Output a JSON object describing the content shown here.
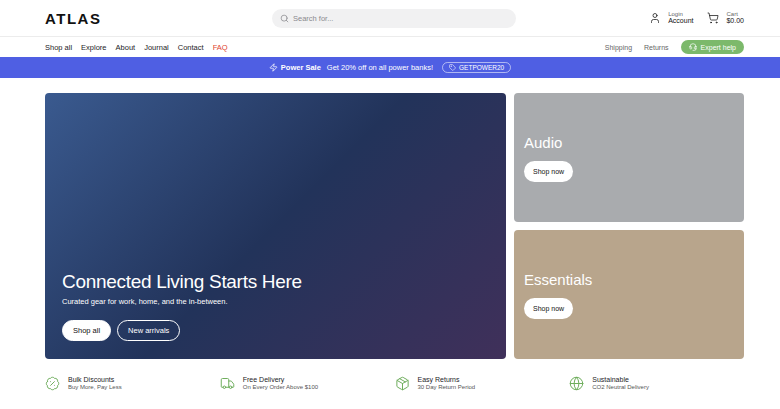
{
  "header": {
    "logo": "ATLAS",
    "search": {
      "placeholder": "Search for..."
    },
    "account": {
      "label": "Login",
      "sub": "Account"
    },
    "cart": {
      "label": "Cart",
      "amount": "$0.00"
    }
  },
  "nav": [
    {
      "label": "Shop all",
      "highlight": false
    },
    {
      "label": "Explore",
      "highlight": false
    },
    {
      "label": "About",
      "highlight": false
    },
    {
      "label": "Journal",
      "highlight": false
    },
    {
      "label": "Contact",
      "highlight": false
    },
    {
      "label": "FAQ",
      "highlight": true
    }
  ],
  "utility_links": [
    "Shipping",
    "Returns"
  ],
  "help_button": "Expert help",
  "banner": {
    "title": "Power Sale",
    "text": "Get 20% off on all power banks!",
    "code": "GETPOWER20"
  },
  "hero": {
    "title": "Connected Living Starts Here",
    "subtitle": "Curated gear for work, home, and the in-between.",
    "buttons": [
      {
        "label": "Shop all",
        "kind": "solid"
      },
      {
        "label": "New arrivals",
        "kind": "outline"
      }
    ]
  },
  "side_cards": [
    {
      "title": "Audio",
      "button": "Shop now"
    },
    {
      "title": "Essentials",
      "button": "Shop now"
    }
  ],
  "features": [
    {
      "title": "Bulk Discounts",
      "sub": "Buy More, Pay Less",
      "kind": "discount"
    },
    {
      "title": "Free Delivery",
      "sub": "On Every Order Above $100",
      "kind": "delivery"
    },
    {
      "title": "Easy Returns",
      "sub": "30 Day Return Period",
      "kind": "returns"
    },
    {
      "title": "Sustainable",
      "sub": "CO2 Neutral Delivery",
      "kind": "sustainable"
    }
  ]
}
